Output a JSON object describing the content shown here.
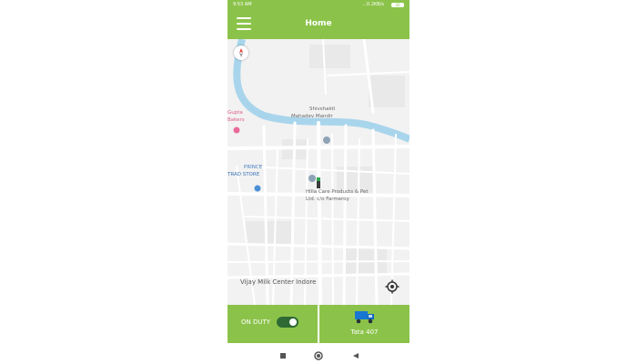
{
  "status_bar": {
    "time": "9:53 AM",
    "network_info": "...0.2KB/s",
    "battery": "42"
  },
  "app_bar": {
    "title": "Home",
    "menu_icon": "hamburger-menu-icon"
  },
  "map": {
    "labels": {
      "place_1": "Shivshakti",
      "place_1b": "Mahadev Mandir",
      "place_2": "Gupta",
      "place_2b": "Bakers",
      "store": "PRINCE",
      "store_b": "TRAD STORE",
      "company": "Hilla Care Products & Pet",
      "company_b": "Ltd. c/o Farmeroy",
      "landmark": "Vijay Milk Center Indore"
    },
    "controls": {
      "compass_icon": "compass-icon",
      "locate_icon": "my-location-icon"
    }
  },
  "bottom_bar": {
    "duty_label": "ON DUTY",
    "duty_toggle_on": true,
    "vehicle_label": "Tata 407",
    "vehicle_icon": "truck-icon"
  },
  "nav_bar": {
    "buttons": [
      "recents-square-icon",
      "home-circle-icon",
      "back-triangle-icon"
    ]
  },
  "colors": {
    "accent": "#8bc34a",
    "toggle_on": "#2e6b34",
    "river": "#a8d5ec"
  }
}
